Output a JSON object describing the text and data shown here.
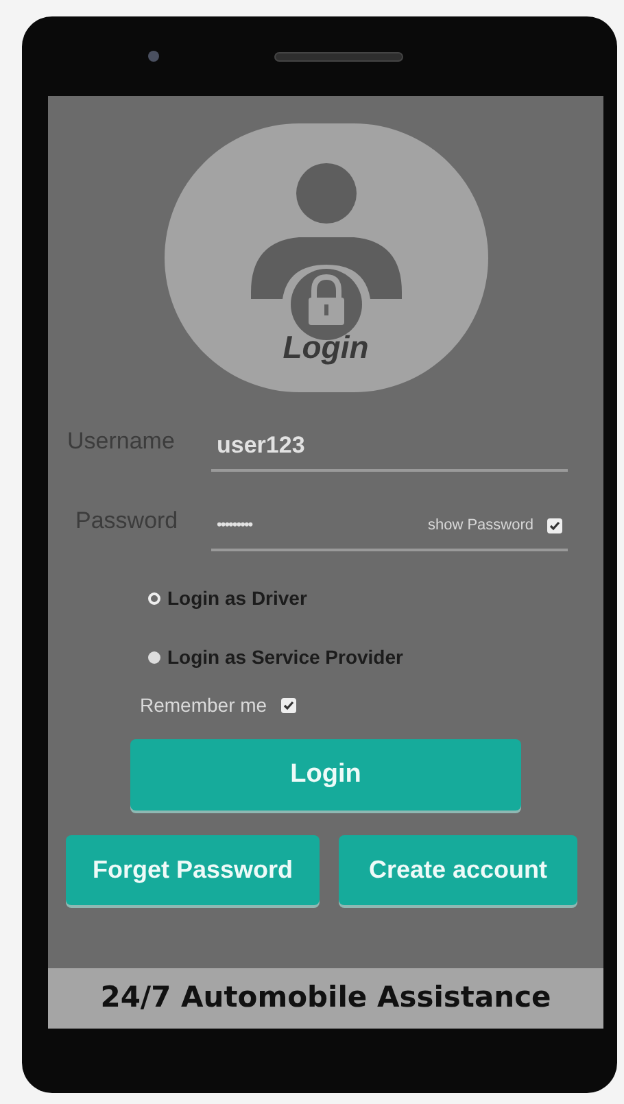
{
  "avatar": {
    "caption": "Login"
  },
  "username": {
    "label": "Username",
    "value": "user123"
  },
  "password": {
    "label": "Password",
    "value": "•••••••••",
    "show_password": {
      "label": "show Password",
      "checked": true
    }
  },
  "roles": [
    {
      "label": "Login as Driver",
      "selected": true
    },
    {
      "label": "Login as Service Provider",
      "selected": false
    }
  ],
  "remember_me": {
    "label": "Remember me",
    "checked": true
  },
  "buttons": {
    "login": "Login",
    "forgot": "Forget Password",
    "create": "Create account"
  },
  "footer": "24/7 Automobile Assistance"
}
